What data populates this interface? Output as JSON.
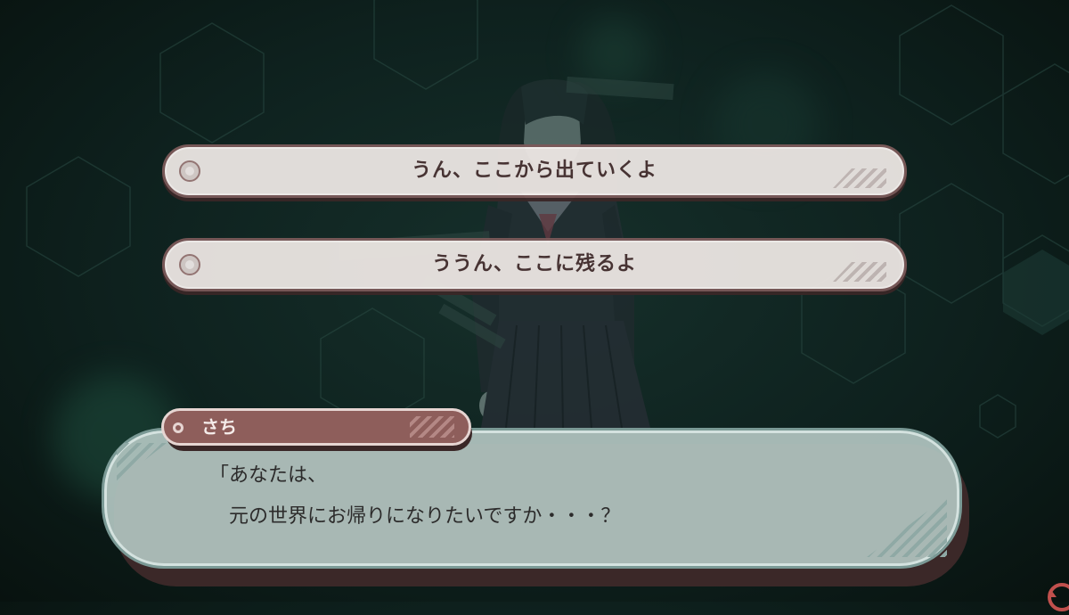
{
  "choices": [
    {
      "label": "うん、ここから出ていくよ"
    },
    {
      "label": "ううん、ここに残るよ"
    }
  ],
  "dialog": {
    "speaker": "さち",
    "text": "「あなたは、\n　元の世界にお帰りになりたいですか・・・？"
  },
  "icons": {
    "choice_marker": "circle-radio-icon",
    "nameplate_marker": "circle-dot-icon",
    "corner": "back-arrow-icon"
  },
  "colors": {
    "choice_bg": "#ece6e3",
    "choice_border": "#7c5a5a",
    "choice_text": "#4a3434",
    "nameplate_bg": "#8e5e5b",
    "dialog_bg": "#b0c4c0",
    "background": "#0e211e",
    "corner_icon": "#c0504d"
  }
}
